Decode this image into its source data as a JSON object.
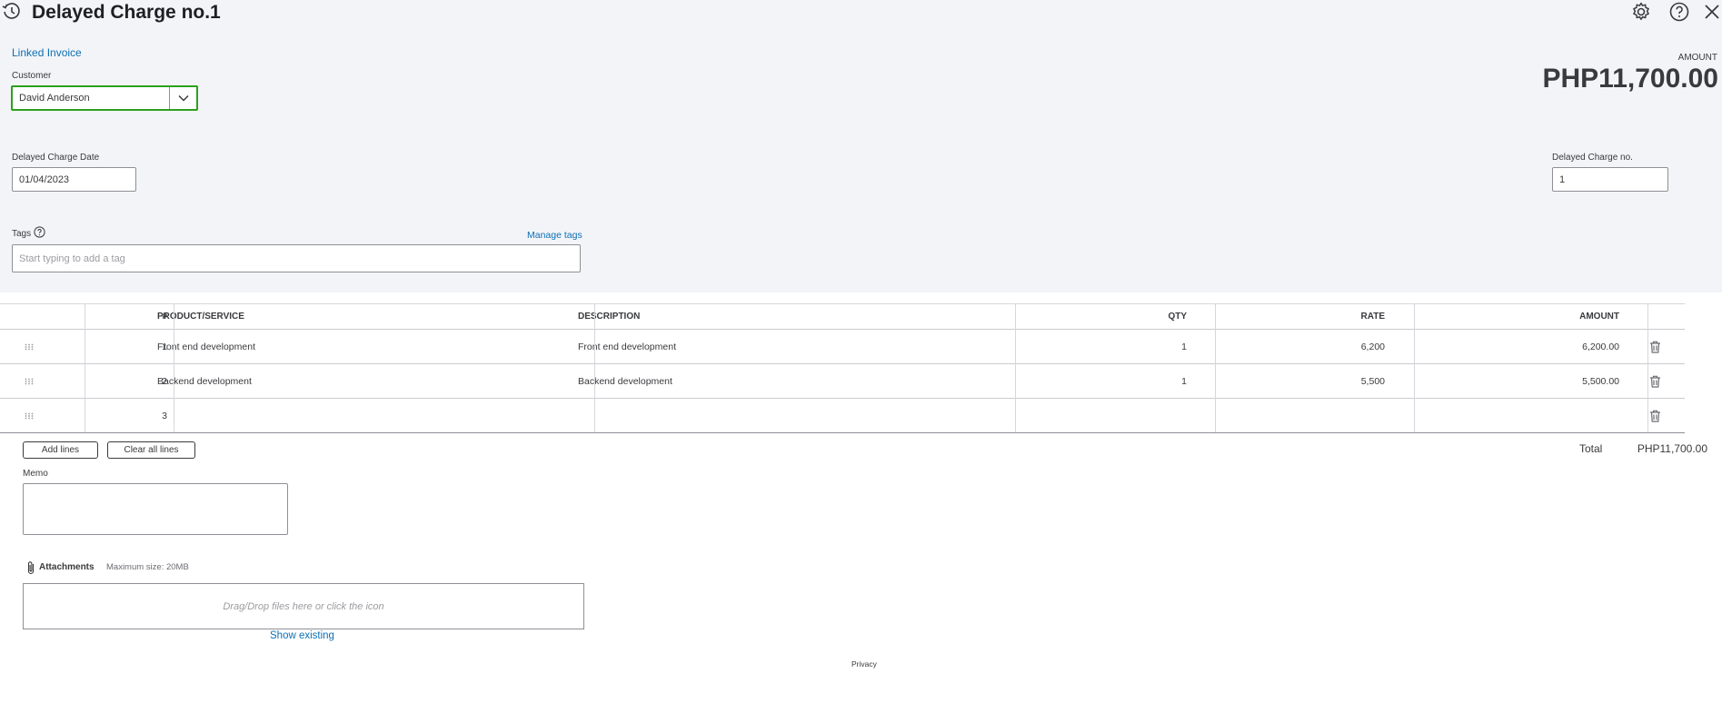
{
  "header": {
    "title": "Delayed Charge no.1",
    "title_icon": "delayed-charge-clock-icon",
    "settings_icon": "gear-icon",
    "help_icon": "help-icon",
    "close_icon": "close-icon"
  },
  "linked_invoice": "Linked Invoice",
  "customer": {
    "label": "Customer",
    "value": "David Anderson"
  },
  "amount": {
    "label": "AMOUNT",
    "value": "PHP11,700.00"
  },
  "date": {
    "label": "Delayed Charge Date",
    "value": "01/04/2023"
  },
  "charge_no": {
    "label": "Delayed Charge no.",
    "value": "1"
  },
  "tags": {
    "label": "Tags",
    "manage": "Manage tags",
    "placeholder": "Start typing to add a tag"
  },
  "table": {
    "headers": {
      "num": "#",
      "product": "PRODUCT/SERVICE",
      "description": "DESCRIPTION",
      "qty": "QTY",
      "rate": "RATE",
      "amount": "AMOUNT"
    },
    "rows": [
      {
        "num": "1",
        "product": "Front end development",
        "description": "Front end development",
        "qty": "1",
        "rate": "6,200",
        "amount": "6,200.00"
      },
      {
        "num": "2",
        "product": "Backend development",
        "description": "Backend development",
        "qty": "1",
        "rate": "5,500",
        "amount": "5,500.00"
      },
      {
        "num": "3",
        "product": "",
        "description": "",
        "qty": "",
        "rate": "",
        "amount": ""
      }
    ]
  },
  "buttons": {
    "add_lines": "Add lines",
    "clear_all": "Clear all lines"
  },
  "total": {
    "label": "Total",
    "value": "PHP11,700.00"
  },
  "memo": {
    "label": "Memo"
  },
  "attachments": {
    "label": "Attachments",
    "max_size": "Maximum size: 20MB",
    "drop_text": "Drag/Drop files here or click the icon",
    "show_existing": "Show existing"
  },
  "footer": {
    "privacy": "Privacy"
  },
  "colors": {
    "accent_green": "#2ca01c",
    "link_blue": "#0d70b5",
    "header_bg": "#f3f4f7"
  }
}
